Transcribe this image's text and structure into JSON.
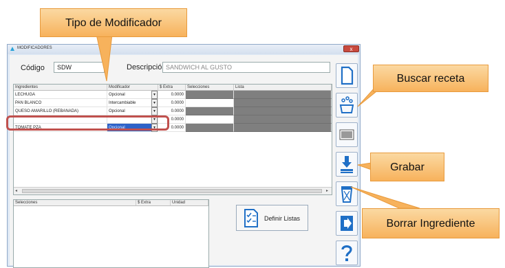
{
  "window": {
    "title": "MODIFICADORES",
    "close_label": "x"
  },
  "header": {
    "code_label": "Código",
    "code_value": "SDW",
    "desc_label": "Descripción",
    "desc_value": "SANDWICH AL GUSTO"
  },
  "grid": {
    "columns": [
      "Ingredientes",
      "Modificador",
      "$ Extra",
      "Selecciones",
      "Lista"
    ],
    "rows": [
      {
        "ingrediente": "LECHUGA",
        "modificador": "Opcional",
        "extra": "0.0000"
      },
      {
        "ingrediente": "PAN BLANCO",
        "modificador": "Intercambiable",
        "extra": "0.0000"
      },
      {
        "ingrediente": "QUESO AMARILLO (REBANADA)",
        "modificador": "Opcional",
        "extra": "0.0000"
      },
      {
        "ingrediente": "",
        "modificador": "",
        "extra": "0.0000"
      },
      {
        "ingrediente": "TOMATE PZA",
        "modificador": "Opcional",
        "extra": "0.0000"
      }
    ]
  },
  "lower_grid": {
    "columns": [
      "Selecciones",
      "$ Extra",
      "Unidad"
    ]
  },
  "buttons": {
    "definir_listas": "Definir Listas"
  },
  "icons": [
    "new-document-icon",
    "search-recipe-icon",
    "barcode-icon",
    "save-icon",
    "trash-icon",
    "exit-icon",
    "help-icon"
  ],
  "callouts": {
    "tipo_modificador": "Tipo de Modificador",
    "buscar_receta": "Buscar receta",
    "grabar": "Grabar",
    "borrar_ingrediente": "Borrar Ingrediente"
  },
  "colors": {
    "callout": "#f7b25c",
    "highlight": "#c0504d",
    "icon_blue": "#1f6fc6",
    "selection": "#2d62c8"
  }
}
